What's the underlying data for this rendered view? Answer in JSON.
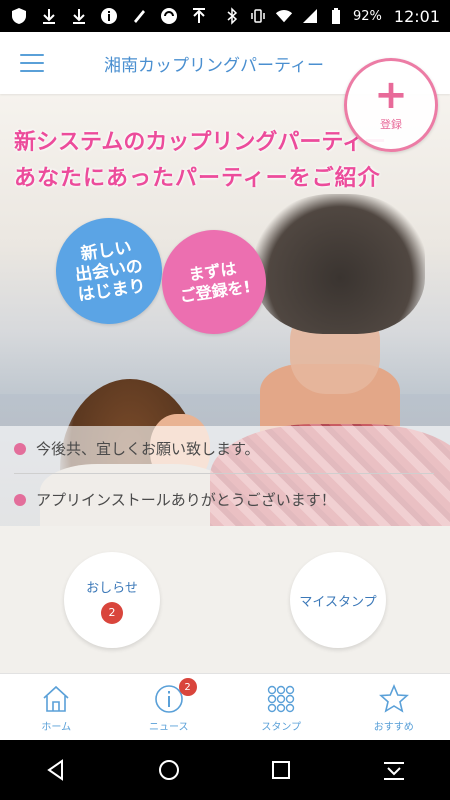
{
  "status_bar": {
    "battery": "92%",
    "time": "12:01",
    "icons": [
      "shield-icon",
      "download-icon",
      "download-icon",
      "info-icon",
      "pencil-icon",
      "sync-icon",
      "upload-icon",
      "bluetooth-icon",
      "vibrate-icon",
      "wifi-icon",
      "signal-icon",
      "battery-icon"
    ]
  },
  "header": {
    "title": "湘南カップリングパーティー"
  },
  "register": {
    "plus": "+",
    "label": "登録"
  },
  "hero": {
    "line1": "新システムのカップリングパーティー",
    "line2": "あなたにあったパーティーをご紹介",
    "bubble_blue": "新しい\n出会いの\nはじまり",
    "bubble_pink": "まずは\nご登録を!"
  },
  "notices": [
    "今後共、宜しくお願い致します。",
    "アプリインストールありがとうございます！"
  ],
  "buttons": {
    "news_label": "おしらせ",
    "news_badge": "2",
    "stamp_label": "マイスタンプ"
  },
  "bottom_nav": [
    {
      "label": "ホーム",
      "icon": "home-icon"
    },
    {
      "label": "ニュース",
      "icon": "info-icon",
      "badge": "2"
    },
    {
      "label": "スタンプ",
      "icon": "grid-icon"
    },
    {
      "label": "おすすめ",
      "icon": "star-icon"
    }
  ],
  "colors": {
    "accent_blue": "#5aa0d8",
    "accent_pink": "#ec4c9b",
    "badge_red": "#d9453c"
  }
}
